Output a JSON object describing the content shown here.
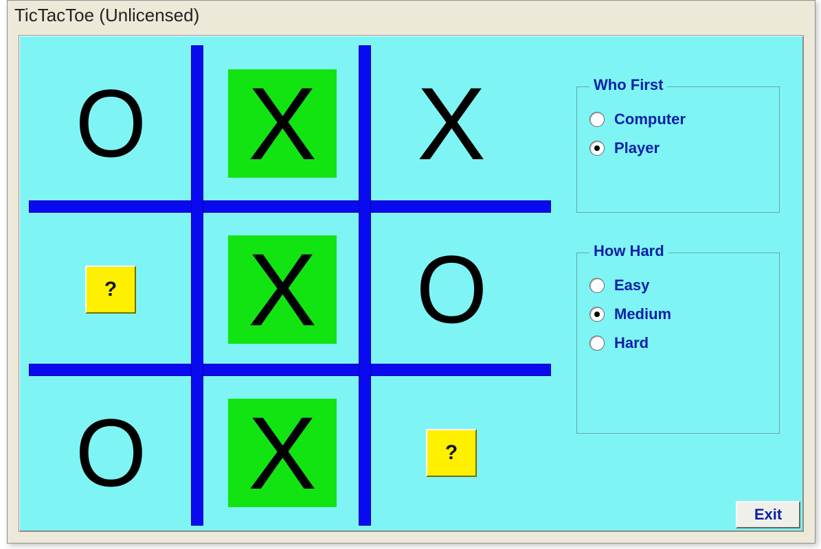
{
  "window": {
    "title": "TicTacToe  (Unlicensed)"
  },
  "board": {
    "cells": [
      [
        {
          "mark": "O",
          "highlight": false,
          "hint": false
        },
        {
          "mark": "X",
          "highlight": true,
          "hint": false
        },
        {
          "mark": "X",
          "highlight": false,
          "hint": false
        }
      ],
      [
        {
          "mark": "",
          "highlight": false,
          "hint": true
        },
        {
          "mark": "X",
          "highlight": true,
          "hint": false
        },
        {
          "mark": "O",
          "highlight": false,
          "hint": false
        }
      ],
      [
        {
          "mark": "O",
          "highlight": false,
          "hint": false
        },
        {
          "mark": "X",
          "highlight": true,
          "hint": false
        },
        {
          "mark": "",
          "highlight": false,
          "hint": true
        }
      ]
    ],
    "hint_glyph": "?"
  },
  "who_first": {
    "legend": "Who First",
    "options": [
      {
        "label": "Computer",
        "selected": false
      },
      {
        "label": "Player",
        "selected": true
      }
    ]
  },
  "how_hard": {
    "legend": "How Hard",
    "options": [
      {
        "label": "Easy",
        "selected": false
      },
      {
        "label": "Medium",
        "selected": true
      },
      {
        "label": "Hard",
        "selected": false
      }
    ]
  },
  "exit": {
    "label": "Exit"
  },
  "colors": {
    "board_bg": "#7FF4F4",
    "grid": "#0a0af0",
    "highlight": "#12E412",
    "hint_bg": "#FFF000",
    "accent_text": "#0b1fa8"
  }
}
